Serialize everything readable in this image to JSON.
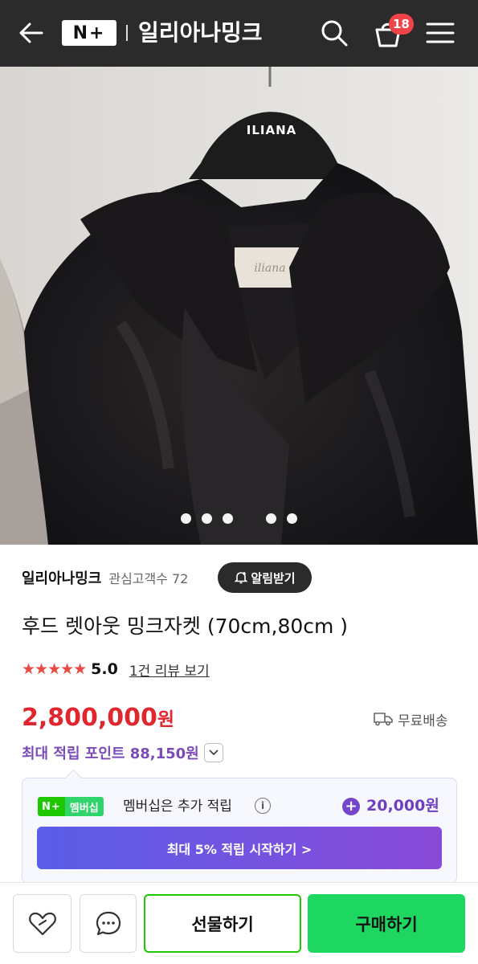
{
  "header": {
    "logo": "N+",
    "store_name": "일리아나밍크",
    "cart_count": "18"
  },
  "gallery": {
    "hanger_brand": "ILIANA",
    "label_text": "iliana",
    "dot_count": 5
  },
  "seller": {
    "name": "일리아나밍크",
    "followers": "관심고객수 72",
    "alarm_button": "알림받기"
  },
  "product": {
    "title": "후드 렛아웃 밍크자켓 (70cm,80cm )",
    "stars": "★★★★★",
    "rating": "5.0",
    "review_link": "1건 리뷰 보기",
    "price_number": "2,800,000",
    "price_unit": "원",
    "shipping": "무료배송",
    "points": "최대 적립 포인트 88,150원"
  },
  "membership": {
    "badge_logo": "N+",
    "badge_label": "멤버십",
    "text": "멤버십은 추가 적립",
    "info": "i",
    "plus": "+",
    "amount": "20,000원",
    "cta": "최대 5% 적립 시작하기 >"
  },
  "bottom_bar": {
    "gift": "선물하기",
    "buy": "구매하기"
  },
  "colors": {
    "header_bg": "#2b2b2b",
    "price_red": "#e0262f",
    "points_purple": "#7b4bb8",
    "naver_green": "#1ed760",
    "badge_red": "#f0434a"
  }
}
